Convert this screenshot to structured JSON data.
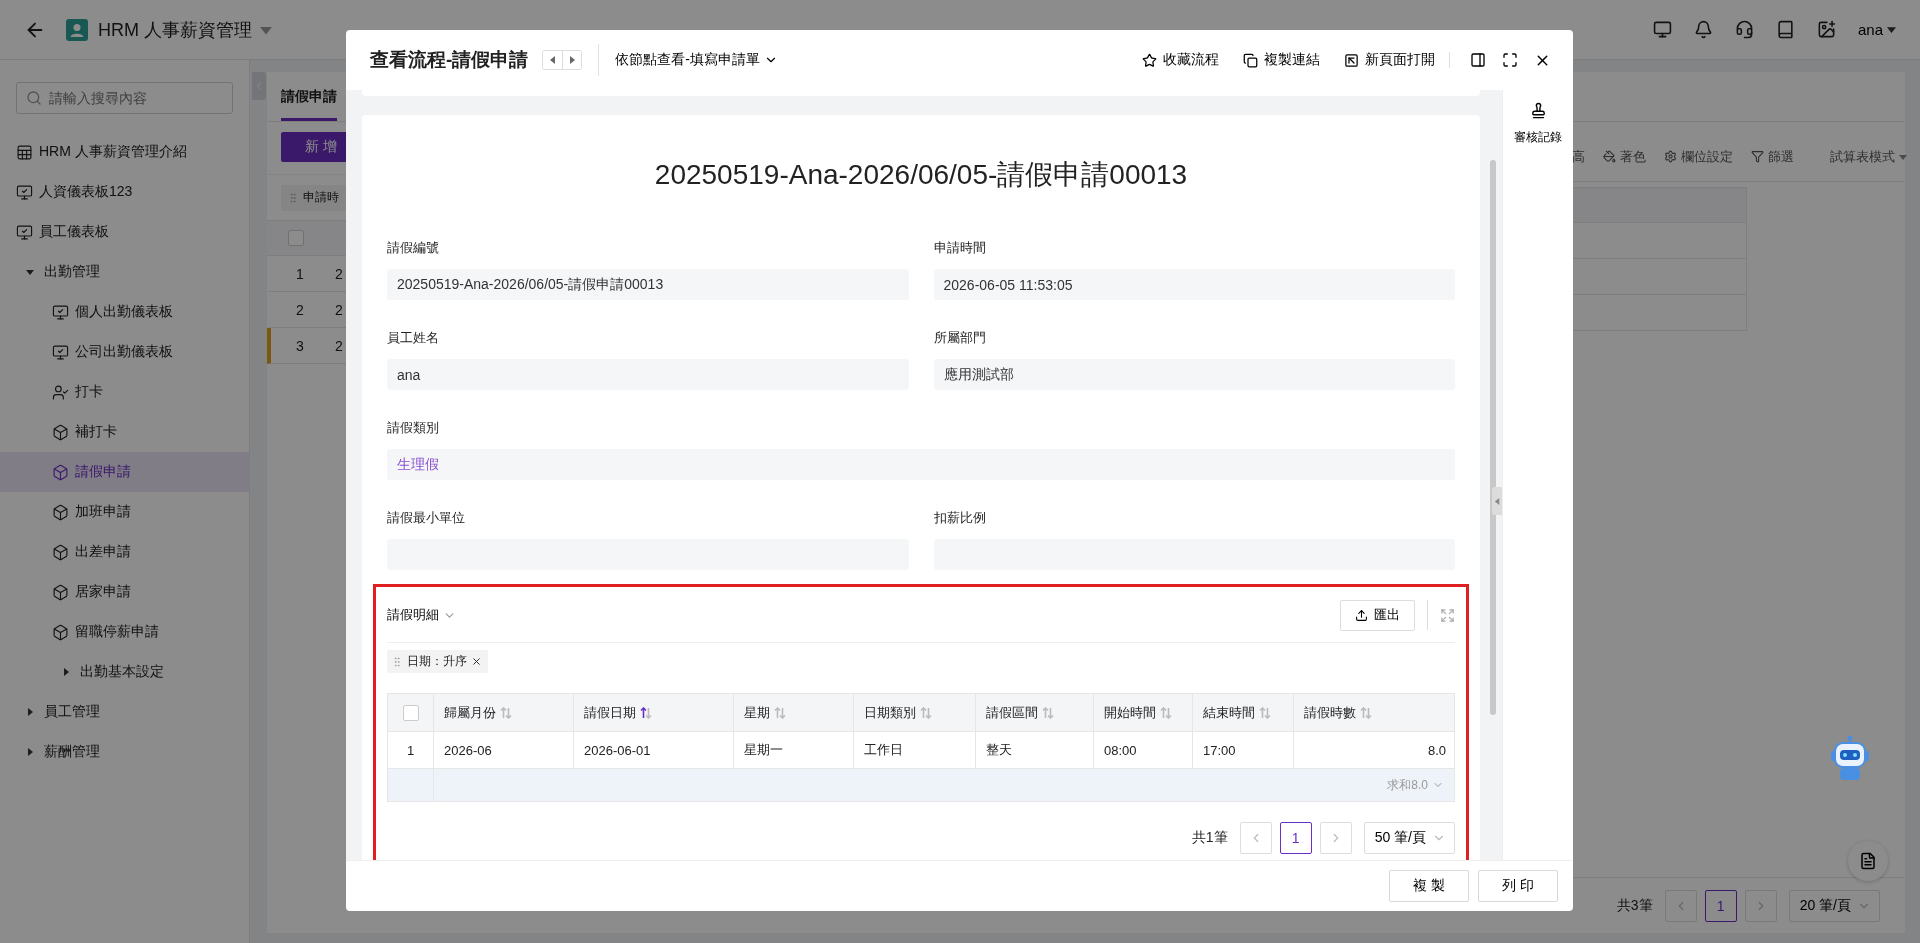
{
  "top_bar": {
    "app_title": "HRM 人事薪資管理",
    "user": "ana"
  },
  "sidebar": {
    "search_placeholder": "請輸入搜尋內容",
    "items": [
      {
        "kind": "table",
        "label": "HRM 人事薪資管理介紹",
        "selected": false
      },
      {
        "kind": "dashboard",
        "label": "人資儀表板123",
        "selected": false
      },
      {
        "kind": "dashboard",
        "label": "員工儀表板",
        "selected": false
      },
      {
        "kind": "group",
        "label": "出勤管理",
        "expanded": true,
        "children": [
          {
            "kind": "dashboard",
            "label": "個人出勤儀表板",
            "selected": false
          },
          {
            "kind": "dashboard",
            "label": "公司出勤儀表板",
            "selected": false
          },
          {
            "kind": "person",
            "label": "打卡",
            "selected": false
          },
          {
            "kind": "cube",
            "label": "補打卡",
            "selected": false
          },
          {
            "kind": "cube",
            "label": "請假申請",
            "selected": true
          },
          {
            "kind": "cube",
            "label": "加班申請",
            "selected": false
          },
          {
            "kind": "cube",
            "label": "出差申請",
            "selected": false
          },
          {
            "kind": "cube",
            "label": "居家申請",
            "selected": false
          },
          {
            "kind": "cube",
            "label": "留職停薪申請",
            "selected": false
          },
          {
            "kind": "group",
            "label": "出勤基本設定",
            "expanded": false
          }
        ]
      },
      {
        "kind": "group",
        "label": "員工管理",
        "expanded": false
      },
      {
        "kind": "group",
        "label": "薪酬管理",
        "expanded": false
      }
    ]
  },
  "main": {
    "tab": {
      "label": "請假申請",
      "selected": true
    },
    "add_button": "新 增",
    "sort_chip": "申請時",
    "select_all": {
      "checked": false
    },
    "rows": [
      {
        "index": "1",
        "cell": "2",
        "marked": false
      },
      {
        "index": "2",
        "cell": "2",
        "marked": false
      },
      {
        "index": "3",
        "cell": "2",
        "marked": true
      }
    ],
    "toolbar": [
      {
        "kind": "plain",
        "label": "高"
      },
      {
        "kind": "paint",
        "label": "著色"
      },
      {
        "kind": "gear",
        "label": "欄位設定"
      },
      {
        "kind": "filter",
        "label": "篩選"
      }
    ],
    "view_mode": "試算表模式",
    "pagination": {
      "total": "共3筆",
      "pages": [
        {
          "label": "1",
          "selected": true
        }
      ],
      "page_size": "20 筆/頁"
    }
  },
  "modal": {
    "title": "查看流程-請假申請",
    "view_select": "依節點查看-填寫申請單",
    "actions": [
      {
        "kind": "star",
        "label": "收藏流程"
      },
      {
        "kind": "copy",
        "label": "複製連結"
      },
      {
        "kind": "open",
        "label": "新頁面打開"
      }
    ],
    "rail_label": "審核記錄",
    "record_title": "20250519-Ana-2026/06/05-請假申請00013",
    "field_rows": [
      [
        {
          "label": "請假編號",
          "value": "20250519-Ana-2026/06/05-請假申請00013",
          "kind": "text"
        },
        {
          "label": "申請時間",
          "value": "2026-06-05 11:53:05",
          "kind": "text"
        }
      ],
      [
        {
          "label": "員工姓名",
          "value": "ana",
          "kind": "text"
        },
        {
          "label": "所屬部門",
          "value": "應用測試部",
          "kind": "text"
        }
      ],
      [
        {
          "label": "請假類別",
          "value": "生理假",
          "kind": "option"
        }
      ],
      [
        {
          "label": "請假最小單位",
          "kind": "text"
        },
        {
          "label": "扣薪比例",
          "kind": "text"
        }
      ]
    ],
    "detail": {
      "title": "請假明細",
      "highlighted": true,
      "export_label": "匯出",
      "sort_chip": "日期：升序",
      "select_all": {
        "checked": false
      },
      "columns": [
        {
          "label": "歸屬月份",
          "sorted": false
        },
        {
          "label": "請假日期",
          "sorted": true
        },
        {
          "label": "星期",
          "sorted": false
        },
        {
          "label": "日期類別",
          "sorted": false
        },
        {
          "label": "請假區間",
          "sorted": false
        },
        {
          "label": "開始時間",
          "sorted": false
        },
        {
          "label": "結束時間",
          "sorted": false
        },
        {
          "label": "請假時數",
          "sorted": false
        }
      ],
      "rows": [
        {
          "index": "1",
          "cells": [
            "2026-06",
            "2026-06-01",
            "星期一",
            "工作日",
            "整天",
            "08:00",
            "17:00",
            "8.0"
          ]
        }
      ],
      "summary": "求和8.0",
      "pagination": {
        "total": "共1筆",
        "pages": [
          {
            "label": "1",
            "selected": true
          }
        ],
        "page_size": "50 筆/頁"
      }
    },
    "footer_buttons": [
      "複 製",
      "列 印"
    ]
  }
}
